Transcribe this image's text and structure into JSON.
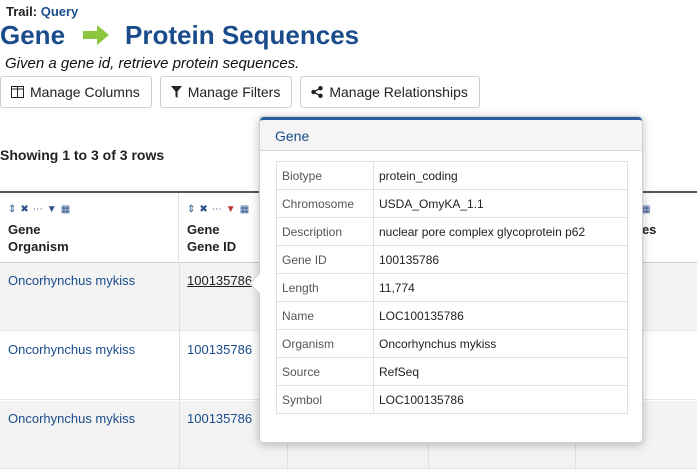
{
  "trail": {
    "label": "Trail:",
    "link": "Query"
  },
  "title": {
    "left": "Gene",
    "right": "Protein Sequences"
  },
  "subtitle": "Given a gene id, retrieve protein sequences.",
  "buttons": {
    "manage_columns": "Manage Columns",
    "manage_filters": "Manage Filters",
    "manage_relationships": "Manage Relationships"
  },
  "showing": "Showing 1 to 3 of 3 rows",
  "columns": [
    {
      "line1": "Gene",
      "line2": "Organism"
    },
    {
      "line1": "Gene",
      "line2": "Gene ID"
    },
    {
      "line1": "",
      "line2": "des"
    }
  ],
  "rows": [
    {
      "organism": "Oncorhynchus mykiss",
      "gene_id": "100135786"
    },
    {
      "organism": "Oncorhynchus mykiss",
      "gene_id": "100135786"
    },
    {
      "organism": "Oncorhynchus mykiss",
      "gene_id": "100135786"
    }
  ],
  "popover": {
    "title": "Gene",
    "fields": [
      {
        "key": "Biotype",
        "value": "protein_coding"
      },
      {
        "key": "Chromosome",
        "value": "USDA_OmyKA_1.1"
      },
      {
        "key": "Description",
        "value": "nuclear pore complex glycoprotein p62"
      },
      {
        "key": "Gene ID",
        "value": "100135786"
      },
      {
        "key": "Length",
        "value": "11,774"
      },
      {
        "key": "Name",
        "value": "LOC100135786"
      },
      {
        "key": "Organism",
        "value": "Oncorhynchus mykiss"
      },
      {
        "key": "Source",
        "value": "RefSeq"
      },
      {
        "key": "Symbol",
        "value": "LOC100135786"
      }
    ]
  },
  "colors": {
    "accent": "#1a4c8b",
    "arrow": "#8cc63f",
    "filter_active": "#c0392b"
  }
}
